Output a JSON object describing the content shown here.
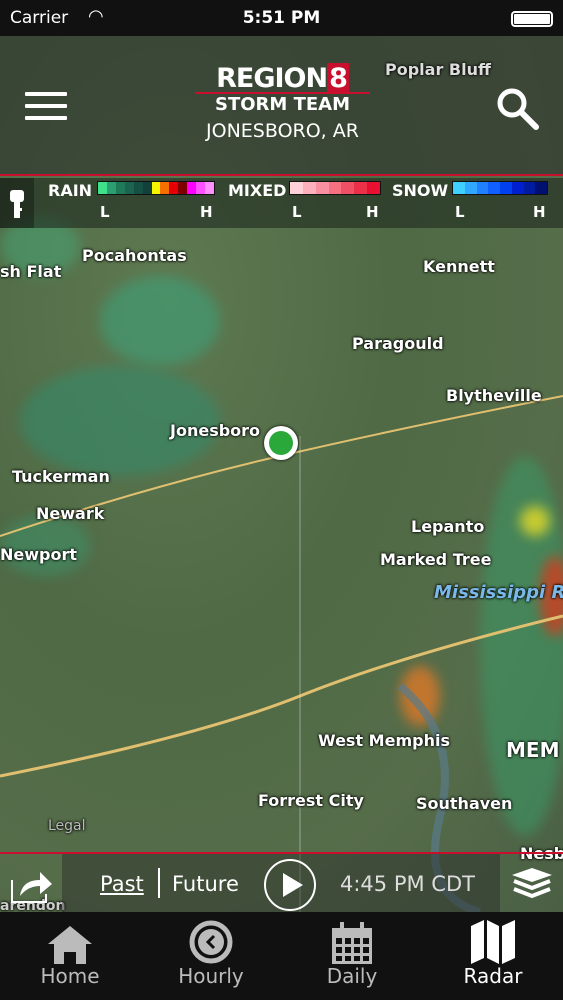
{
  "status_bar": {
    "carrier": "Carrier",
    "time": "5:51 PM"
  },
  "header": {
    "logo_line1": "REGION",
    "logo_num": "8",
    "logo_line2": "STORM TEAM",
    "location": "JONESBORO, AR"
  },
  "legend": {
    "rain": "RAIN",
    "mixed": "MIXED",
    "snow": "SNOW",
    "low": "L",
    "high": "H",
    "rain_colors": [
      "#3fe08a",
      "#2aa070",
      "#1f7a5a",
      "#1a6450",
      "#164f44",
      "#12403a",
      "#f5f500",
      "#f57000",
      "#e60000",
      "#800000",
      "#ff00ff",
      "#ff50ff",
      "#ff90ff"
    ],
    "mixed_colors": [
      "#ffd0d8",
      "#fbb0bc",
      "#f890a0",
      "#f57080",
      "#f05064",
      "#ec3048",
      "#e81030"
    ],
    "snow_colors": [
      "#40d0ff",
      "#30a8ff",
      "#2080ff",
      "#1060ff",
      "#0040f0",
      "#0020d0",
      "#001aa0",
      "#001070"
    ]
  },
  "map": {
    "cities": [
      "Poplar Bluff",
      "Pocahontas",
      "sh Flat",
      "Kennett",
      "Paragould",
      "Blytheville",
      "Jonesboro",
      "Tuckerman",
      "Newark",
      "Newport",
      "Lepanto",
      "Marked Tree",
      "Mississippi R",
      "West Memphis",
      "MEM",
      "Forrest City",
      "Southaven",
      "Nesb",
      "arendon"
    ],
    "legal": "Legal"
  },
  "controls": {
    "past": "Past",
    "future": "Future",
    "timestamp": "4:45 PM CDT"
  },
  "tabs": [
    {
      "label": "Home"
    },
    {
      "label": "Hourly"
    },
    {
      "label": "Daily"
    },
    {
      "label": "Radar"
    }
  ]
}
